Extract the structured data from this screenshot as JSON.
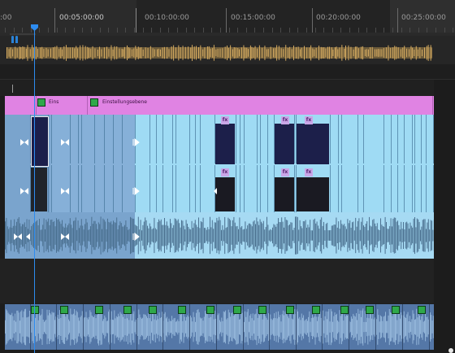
{
  "timeline": {
    "ruler": {
      "timecodes": [
        ":00",
        "00:05:00:00",
        "00:10:00:00",
        "00:15:00:00",
        "00:20:00:00",
        "00:25:00:00"
      ]
    },
    "tracks": {
      "adjustment": {
        "clip_labels": [
          "Eins",
          "Einstellungsebene"
        ]
      },
      "video": {
        "fx_label": "fx"
      }
    },
    "colors": {
      "accent": "#2d8cf0",
      "adjustment_clip": "#e083e3",
      "video_clip": "#9fdbf4",
      "audio_clip": "#5477a7",
      "marker": "#e7b866"
    }
  }
}
